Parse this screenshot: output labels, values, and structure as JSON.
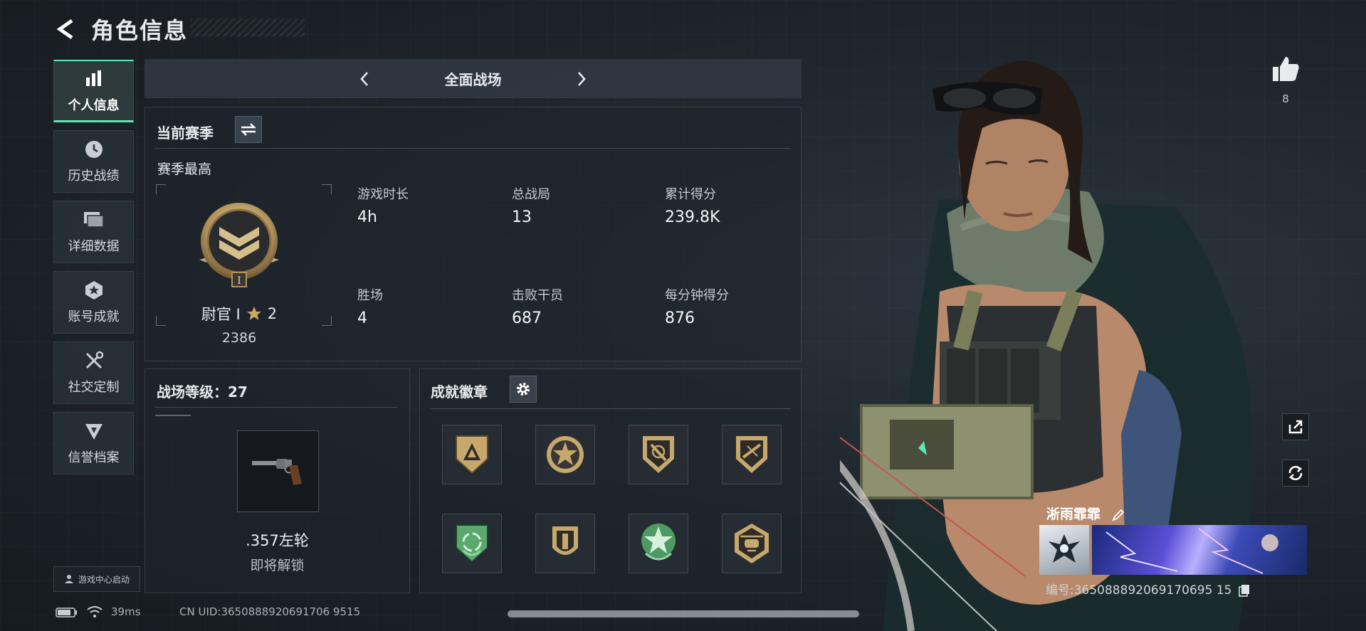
{
  "header": {
    "title": "角色信息"
  },
  "sidebar": {
    "items": [
      {
        "label": "个人信息",
        "icon": "bar-chart-icon",
        "active": true
      },
      {
        "label": "历史战绩",
        "icon": "clock-icon"
      },
      {
        "label": "详细数据",
        "icon": "folder-icon"
      },
      {
        "label": "账号成就",
        "icon": "achievement-icon"
      },
      {
        "label": "社交定制",
        "icon": "tools-icon"
      },
      {
        "label": "信誉档案",
        "icon": "credit-icon"
      }
    ],
    "game_center": "游戏中心启动"
  },
  "mode": {
    "title": "全面战场"
  },
  "season": {
    "title": "当前赛季",
    "best_label": "赛季最高",
    "rank_name": "尉官 I",
    "rank_stars": "2",
    "rank_points": "2386",
    "stats": [
      {
        "label": "游戏时长",
        "value": "4h"
      },
      {
        "label": "总战局",
        "value": "13"
      },
      {
        "label": "累计得分",
        "value": "239.8K"
      },
      {
        "label": "胜场",
        "value": "4"
      },
      {
        "label": "击败干员",
        "value": "687"
      },
      {
        "label": "每分钟得分",
        "value": "876"
      }
    ]
  },
  "level": {
    "title": "战场等级：27",
    "weapon_name": ".357左轮",
    "weapon_status": "即将解锁"
  },
  "badges": {
    "title": "成就徽章"
  },
  "player": {
    "likes": "8",
    "name": "淅雨霏霏",
    "id": "编号:365088892069170695 15"
  },
  "status_bar": {
    "ping": "39ms",
    "uid": "CN UID:3650888920691706 9515"
  },
  "colors": {
    "accent": "#5fe6b6"
  }
}
